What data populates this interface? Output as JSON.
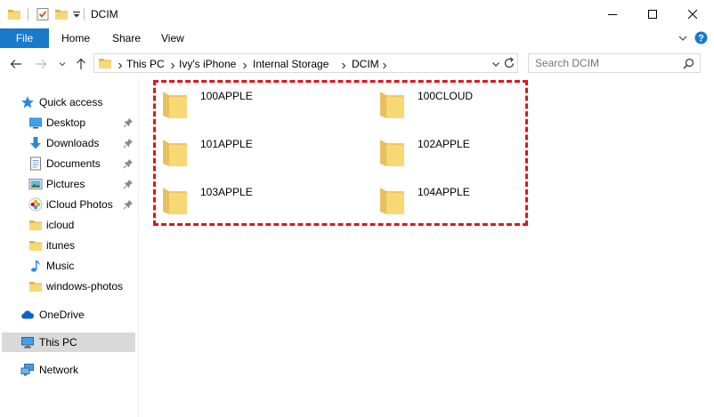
{
  "window": {
    "title": "DCIM"
  },
  "ribbon": {
    "tabs": [
      "File",
      "Home",
      "Share",
      "View"
    ]
  },
  "address": {
    "crumbs": [
      "This PC",
      "Ivy's iPhone",
      "Internal Storage",
      "DCIM"
    ]
  },
  "search": {
    "placeholder": "Search DCIM"
  },
  "nav": {
    "quick_access": "Quick access",
    "items": [
      "Desktop",
      "Downloads",
      "Documents",
      "Pictures",
      "iCloud Photos",
      "icloud",
      "itunes",
      "Music",
      "windows-photos"
    ],
    "onedrive": "OneDrive",
    "thispc": "This PC",
    "network": "Network"
  },
  "folders": [
    "100APPLE",
    "100CLOUD",
    "101APPLE",
    "102APPLE",
    "103APPLE",
    "104APPLE"
  ],
  "colors": {
    "accent": "#1979ca",
    "highlight": "#e3141b",
    "folder": "#f8d775",
    "selected": "#d9d9d9"
  }
}
